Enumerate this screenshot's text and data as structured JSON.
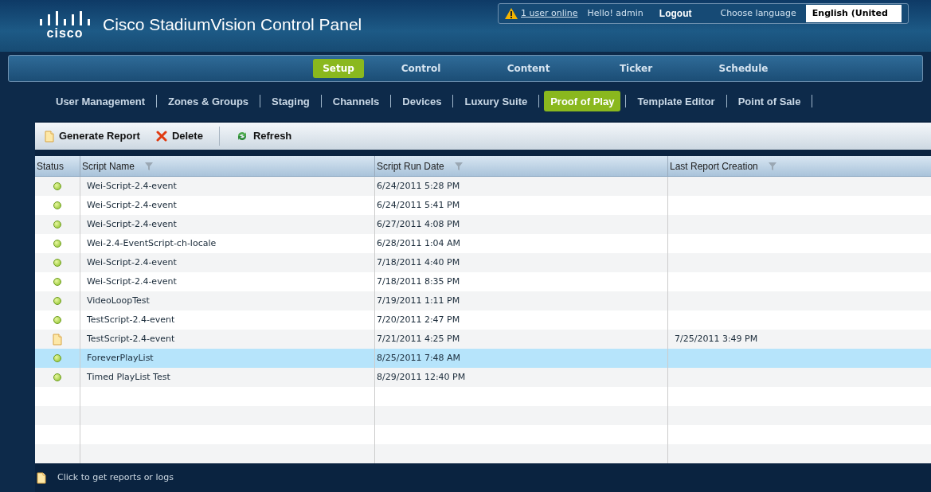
{
  "header": {
    "logo_text": "cisco",
    "title": "Cisco StadiumVision Control Panel",
    "users_online": "1 user online",
    "greeting": "Hello! admin",
    "logout": "Logout",
    "language_label": "Choose language",
    "language": "English (United"
  },
  "main_nav": [
    {
      "label": "Setup",
      "selected": true
    },
    {
      "label": "Control",
      "selected": false
    },
    {
      "label": "Content",
      "selected": false
    },
    {
      "label": "Ticker",
      "selected": false
    },
    {
      "label": "Schedule",
      "selected": false
    }
  ],
  "sub_nav": [
    {
      "label": "User Management",
      "selected": false
    },
    {
      "label": "Zones & Groups",
      "selected": false
    },
    {
      "label": "Staging",
      "selected": false
    },
    {
      "label": "Channels",
      "selected": false
    },
    {
      "label": "Devices",
      "selected": false
    },
    {
      "label": "Luxury Suite",
      "selected": false
    },
    {
      "label": "Proof of Play",
      "selected": true
    },
    {
      "label": "Template Editor",
      "selected": false
    },
    {
      "label": "Point of Sale",
      "selected": false
    }
  ],
  "toolbar": [
    {
      "kind": "report",
      "label": "Generate Report"
    },
    {
      "kind": "delete",
      "label": "Delete"
    },
    {
      "kind": "refresh",
      "label": "Refresh"
    }
  ],
  "table": {
    "columns": [
      "Status",
      "Script Name",
      "Script Run Date",
      "Last Report Creation"
    ],
    "rows": [
      {
        "kind": "ok",
        "name": "Wei-Script-2.4-event",
        "run_date": "6/24/2011 5:28 PM",
        "selected": false
      },
      {
        "kind": "ok",
        "name": "Wei-Script-2.4-event",
        "run_date": "6/24/2011 5:41 PM",
        "selected": false
      },
      {
        "kind": "ok",
        "name": "Wei-Script-2.4-event",
        "run_date": "6/27/2011 4:08 PM",
        "selected": false
      },
      {
        "kind": "ok",
        "name": "Wei-2.4-EventScript-ch-locale",
        "run_date": "6/28/2011 1:04 AM",
        "selected": false
      },
      {
        "kind": "ok",
        "name": "Wei-Script-2.4-event",
        "run_date": "7/18/2011 4:40 PM",
        "selected": false
      },
      {
        "kind": "ok",
        "name": "Wei-Script-2.4-event",
        "run_date": "7/18/2011 8:35 PM",
        "selected": false
      },
      {
        "kind": "ok",
        "name": "VideoLoopTest",
        "run_date": "7/19/2011 1:11 PM",
        "selected": false
      },
      {
        "kind": "ok",
        "name": "TestScript-2.4-event",
        "run_date": "7/20/2011 2:47 PM",
        "selected": false
      },
      {
        "kind": "report",
        "name": "TestScript-2.4-event",
        "run_date": "7/21/2011 4:25 PM",
        "report": "7/25/2011 3:49 PM",
        "selected": false
      },
      {
        "kind": "ok",
        "name": "ForeverPlayList",
        "run_date": "8/25/2011 7:48 AM",
        "selected": true
      },
      {
        "kind": "ok",
        "name": "Timed PlayList Test",
        "run_date": "8/29/2011 12:40 PM",
        "selected": false
      }
    ]
  },
  "footer": {
    "hint": "Click to get reports or logs"
  }
}
